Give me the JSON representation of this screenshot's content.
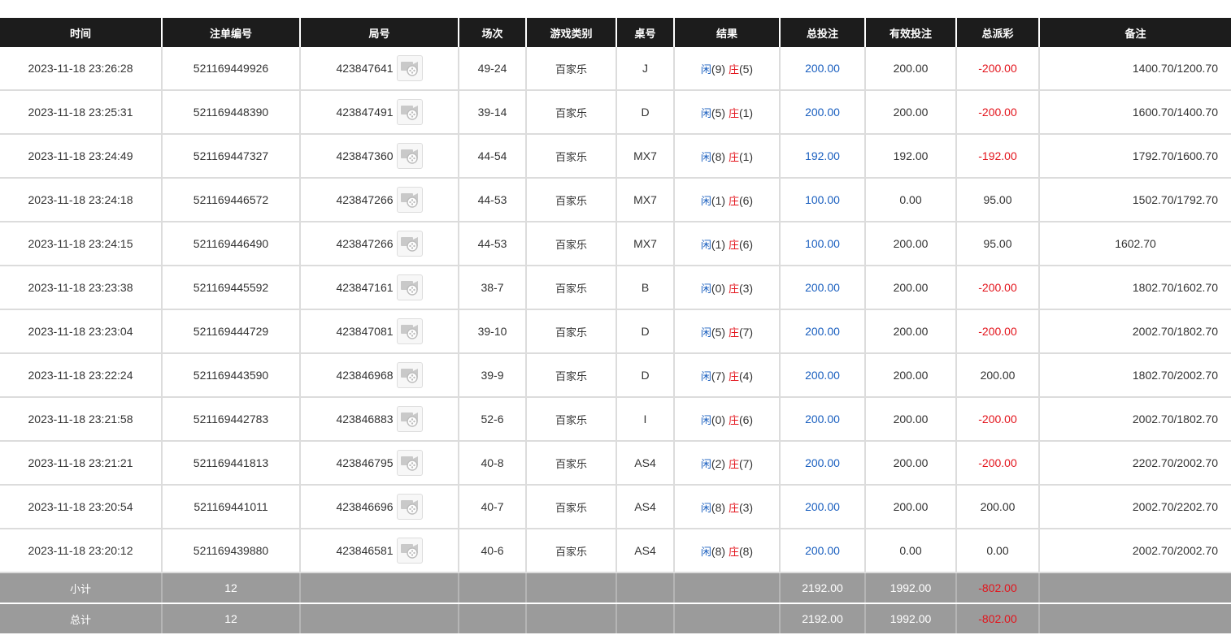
{
  "columns": {
    "time": "时间",
    "bet_no": "注单编号",
    "round_no": "局号",
    "shoe": "场次",
    "game_type": "游戏类别",
    "table": "桌号",
    "result": "结果",
    "total_bet": "总投注",
    "valid_bet": "有效投注",
    "payout": "总派彩",
    "remark": "备注"
  },
  "result_labels": {
    "player": "闲",
    "banker": "庄"
  },
  "rows": [
    {
      "time": "2023-11-18 23:26:28",
      "bet_no": "521169449926",
      "round_no": "423847641",
      "shoe": "49-24",
      "game_type": "百家乐",
      "table": "J",
      "player": "(9)",
      "banker": "(5)",
      "total_bet": "200.00",
      "valid_bet": "200.00",
      "payout": "-200.00",
      "remark": "1400.70/1200.70"
    },
    {
      "time": "2023-11-18 23:25:31",
      "bet_no": "521169448390",
      "round_no": "423847491",
      "shoe": "39-14",
      "game_type": "百家乐",
      "table": "D",
      "player": "(5)",
      "banker": "(1)",
      "total_bet": "200.00",
      "valid_bet": "200.00",
      "payout": "-200.00",
      "remark": "1600.70/1400.70"
    },
    {
      "time": "2023-11-18 23:24:49",
      "bet_no": "521169447327",
      "round_no": "423847360",
      "shoe": "44-54",
      "game_type": "百家乐",
      "table": "MX7",
      "player": "(8)",
      "banker": "(1)",
      "total_bet": "192.00",
      "valid_bet": "192.00",
      "payout": "-192.00",
      "remark": "1792.70/1600.70"
    },
    {
      "time": "2023-11-18 23:24:18",
      "bet_no": "521169446572",
      "round_no": "423847266",
      "shoe": "44-53",
      "game_type": "百家乐",
      "table": "MX7",
      "player": "(1)",
      "banker": "(6)",
      "total_bet": "100.00",
      "valid_bet": "0.00",
      "payout": "95.00",
      "remark": "1502.70/1792.70"
    },
    {
      "time": "2023-11-18 23:24:15",
      "bet_no": "521169446490",
      "round_no": "423847266",
      "shoe": "44-53",
      "game_type": "百家乐",
      "table": "MX7",
      "player": "(1)",
      "banker": "(6)",
      "total_bet": "100.00",
      "valid_bet": "200.00",
      "payout": "95.00",
      "remark": "1602.70"
    },
    {
      "time": "2023-11-18 23:23:38",
      "bet_no": "521169445592",
      "round_no": "423847161",
      "shoe": "38-7",
      "game_type": "百家乐",
      "table": "B",
      "player": "(0)",
      "banker": "(3)",
      "total_bet": "200.00",
      "valid_bet": "200.00",
      "payout": "-200.00",
      "remark": "1802.70/1602.70"
    },
    {
      "time": "2023-11-18 23:23:04",
      "bet_no": "521169444729",
      "round_no": "423847081",
      "shoe": "39-10",
      "game_type": "百家乐",
      "table": "D",
      "player": "(5)",
      "banker": "(7)",
      "total_bet": "200.00",
      "valid_bet": "200.00",
      "payout": "-200.00",
      "remark": "2002.70/1802.70"
    },
    {
      "time": "2023-11-18 23:22:24",
      "bet_no": "521169443590",
      "round_no": "423846968",
      "shoe": "39-9",
      "game_type": "百家乐",
      "table": "D",
      "player": "(7)",
      "banker": "(4)",
      "total_bet": "200.00",
      "valid_bet": "200.00",
      "payout": "200.00",
      "remark": "1802.70/2002.70"
    },
    {
      "time": "2023-11-18 23:21:58",
      "bet_no": "521169442783",
      "round_no": "423846883",
      "shoe": "52-6",
      "game_type": "百家乐",
      "table": "I",
      "player": "(0)",
      "banker": "(6)",
      "total_bet": "200.00",
      "valid_bet": "200.00",
      "payout": "-200.00",
      "remark": "2002.70/1802.70"
    },
    {
      "time": "2023-11-18 23:21:21",
      "bet_no": "521169441813",
      "round_no": "423846795",
      "shoe": "40-8",
      "game_type": "百家乐",
      "table": "AS4",
      "player": "(2)",
      "banker": "(7)",
      "total_bet": "200.00",
      "valid_bet": "200.00",
      "payout": "-200.00",
      "remark": "2202.70/2002.70"
    },
    {
      "time": "2023-11-18 23:20:54",
      "bet_no": "521169441011",
      "round_no": "423846696",
      "shoe": "40-7",
      "game_type": "百家乐",
      "table": "AS4",
      "player": "(8)",
      "banker": "(3)",
      "total_bet": "200.00",
      "valid_bet": "200.00",
      "payout": "200.00",
      "remark": "2002.70/2202.70"
    },
    {
      "time": "2023-11-18 23:20:12",
      "bet_no": "521169439880",
      "round_no": "423846581",
      "shoe": "40-6",
      "game_type": "百家乐",
      "table": "AS4",
      "player": "(8)",
      "banker": "(8)",
      "total_bet": "200.00",
      "valid_bet": "0.00",
      "payout": "0.00",
      "remark": "2002.70/2002.70"
    }
  ],
  "subtotal": {
    "label": "小计",
    "count": "12",
    "total_bet": "2192.00",
    "valid_bet": "1992.00",
    "payout": "-802.00"
  },
  "grand_total": {
    "label": "总计",
    "count": "12",
    "total_bet": "2192.00",
    "valid_bet": "1992.00",
    "payout": "-802.00"
  },
  "icons": {
    "round_video": "video-replay-icon"
  },
  "colors": {
    "header_bg": "#1c1c1c",
    "blue": "#1a5fbf",
    "red": "#e3141c",
    "footer_bg": "#9b9b9b"
  }
}
